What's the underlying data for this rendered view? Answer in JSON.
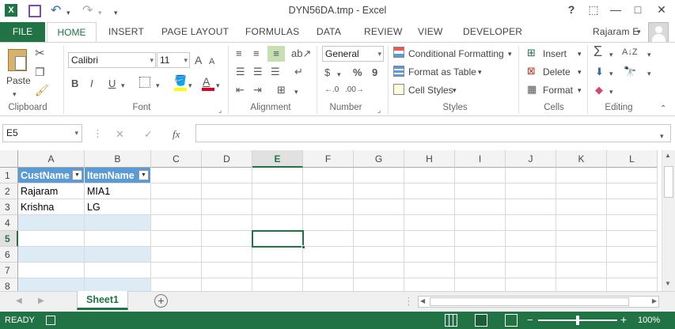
{
  "window": {
    "title": "DYN56DA.tmp - Excel",
    "help": "?",
    "ribbon_display": "⬚",
    "minimize": "—",
    "restore": "□",
    "close": "✕"
  },
  "qat": {
    "app_icon": "X",
    "save_icon": "💾",
    "undo_icon": "↶",
    "redo_icon": "↷",
    "customize_icon": "▾"
  },
  "tabs": {
    "file": "FILE",
    "home": "HOME",
    "insert": "INSERT",
    "page_layout": "PAGE LAYOUT",
    "formulas": "FORMULAS",
    "data": "DATA",
    "review": "REVIEW",
    "view": "VIEW",
    "developer": "DEVELOPER"
  },
  "user": {
    "name": "Rajaram E",
    "caret": "▾"
  },
  "ribbon": {
    "clipboard": {
      "paste": "Paste",
      "label": "Clipboard"
    },
    "font": {
      "name": "Calibri",
      "size": "11",
      "bold": "B",
      "italic": "I",
      "underline": "U",
      "grow": "A",
      "shrink": "A",
      "label": "Font"
    },
    "alignment": {
      "label": "Alignment"
    },
    "number": {
      "format": "General",
      "percent": "%",
      "comma": "9",
      "label": "Number"
    },
    "styles": {
      "conditional": "Conditional Formatting",
      "format_table": "Format as Table",
      "cell_styles": "Cell Styles",
      "label": "Styles"
    },
    "cells": {
      "insert": "Insert",
      "delete": "Delete",
      "format": "Format",
      "label": "Cells"
    },
    "editing": {
      "label": "Editing",
      "sum": "Σ"
    }
  },
  "formula_bar": {
    "name_box": "E5",
    "cancel": "✕",
    "enter": "✓",
    "fx": "fx",
    "value": ""
  },
  "columns": [
    "A",
    "B",
    "C",
    "D",
    "E",
    "F",
    "G",
    "H",
    "I",
    "J",
    "K",
    "L"
  ],
  "rows": [
    "1",
    "2",
    "3",
    "4",
    "5",
    "6",
    "7",
    "8"
  ],
  "table": {
    "headers": [
      "CustName",
      "ItemName"
    ],
    "rows": [
      [
        "Rajaram",
        "MIA1"
      ],
      [
        "Krishna",
        "LG"
      ]
    ]
  },
  "active_cell": "E5",
  "sheets": {
    "tabs": [
      "Sheet1"
    ],
    "add": "+"
  },
  "status": {
    "mode": "READY",
    "zoom": "100%",
    "zoom_minus": "−",
    "zoom_plus": "+"
  },
  "colors": {
    "brand": "#217346",
    "table_header": "#5b9bd5",
    "table_band": "#ddebf7"
  }
}
